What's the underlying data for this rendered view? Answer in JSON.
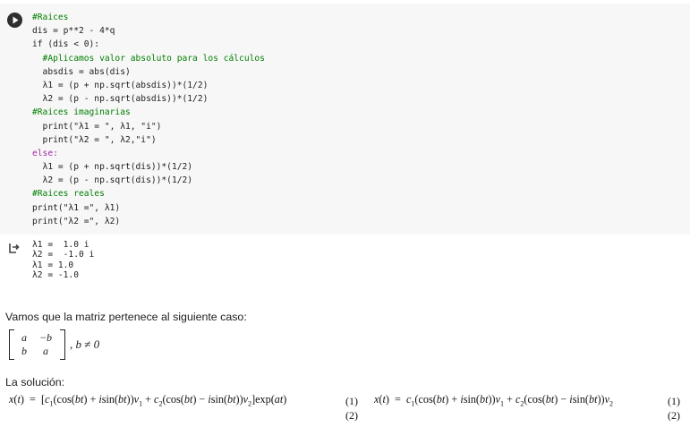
{
  "code_lines": [
    "#Raices",
    "dis = p**2 - 4*q",
    "if (dis < 0):",
    "  #Aplicamos valor absoluto para los cálculos",
    "  absdis = abs(dis)",
    "  λ1 = (p + np.sqrt(absdis))*(1/2)",
    "  λ2 = (p - np.sqrt(absdis))*(1/2)",
    "#Raices imaginarias",
    "  print(\"λ1 = \", λ1, \"i\")",
    "  print(\"λ2 = \", λ2,\"i\")",
    "else:",
    "  λ1 = (p + np.sqrt(dis))*(1/2)",
    "  λ2 = (p - np.sqrt(dis))*(1/2)",
    "#Raices reales",
    "print(\"λ1 =\", λ1)",
    "print(\"λ2 =\", λ2)"
  ],
  "output_lines": [
    "λ1 =  1.0 i",
    "λ2 =  -1.0 i",
    "λ1 = 1.0",
    "λ2 = -1.0"
  ],
  "text": {
    "matrix_intro": "Vamos que la matriz pertenece al siguiente caso:",
    "solution_label": "La solución:"
  },
  "matrix": {
    "row1": [
      "a",
      "−b"
    ],
    "row2": [
      "b",
      "a"
    ],
    "condition": ", b ≠ 0"
  },
  "equations": {
    "eq_number_1": "(1)",
    "eq_number_2": "(2)"
  },
  "icons": {
    "run": "play-circle-icon",
    "output": "output-arrow-icon"
  },
  "colors": {
    "cell_bg": "#f7f7f7",
    "comment": "#007f00",
    "keyword": "#9e2aa2",
    "string": "#b5561d",
    "number": "#0b7f75"
  }
}
